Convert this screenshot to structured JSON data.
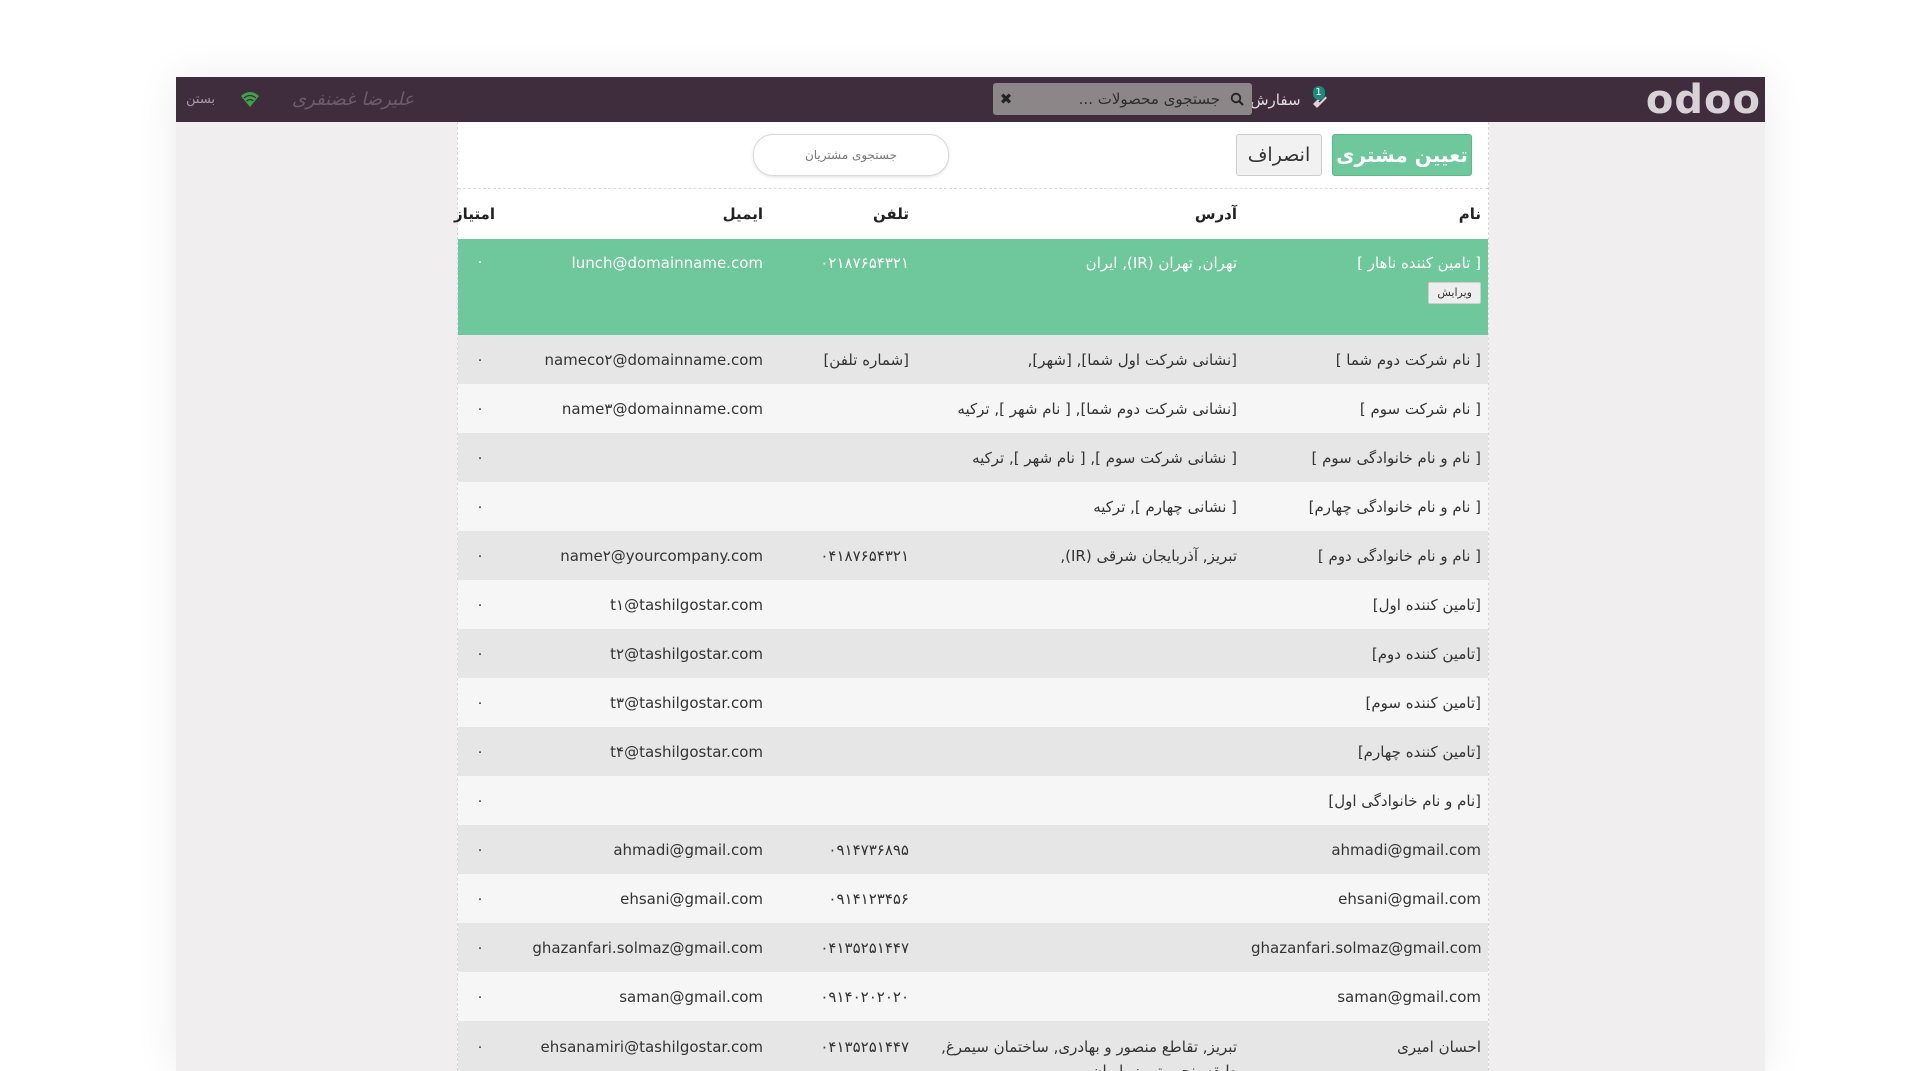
{
  "app": {
    "logo": "odoo"
  },
  "header": {
    "orders_label": "سفارش ها",
    "orders_badge": "1",
    "product_search_placeholder": "جستجوی محصولات ...",
    "user_name": "علیرضا غضنفری",
    "close_label": "بستن"
  },
  "actions": {
    "assign_label": "تعیین مشتری",
    "cancel_label": "انصراف",
    "customer_search_placeholder": "جستجوی مشتریان"
  },
  "table": {
    "headers": {
      "name": "نام",
      "address": "آدرس",
      "phone": "تلفن",
      "email": "ایمیل",
      "points": "امتیاز"
    },
    "edit_label": "ویرایش",
    "rows": [
      {
        "name": "[ تامین کننده ناهار ]",
        "address": "تهران, تهران (IR), ایران",
        "phone": "۰۲۱۸۷۶۵۴۳۲۱",
        "email": "lunch@domainname.com",
        "points": "۰"
      },
      {
        "name": "[ نام شرکت دوم شما ]",
        "address": "[نشانی شرکت اول شما], [شهر],",
        "phone": "[شماره تلفن]",
        "email": "nameco۲@domainname.com",
        "points": "۰"
      },
      {
        "name": "[ نام شرکت سوم ]",
        "address": "[نشانی شرکت دوم شما], [ نام شهر ], ترکیه",
        "phone": "",
        "email": "name۳@domainname.com",
        "points": "۰"
      },
      {
        "name": "[ نام و نام خانوادگی سوم ]",
        "address": "[ نشانی شرکت سوم ], [ نام شهر ], ترکیه",
        "phone": "",
        "email": "",
        "points": "۰"
      },
      {
        "name": "[ نام و نام خانوادگی چهارم]",
        "address": "[ نشانی چهارم ], ترکیه",
        "phone": "",
        "email": "",
        "points": "۰"
      },
      {
        "name": "[ نام و نام خانوادگی دوم ]",
        "address": "تبریز, آذربایجان شرقی (IR),",
        "phone": "۰۴۱۸۷۶۵۴۳۲۱",
        "email": "name۲@yourcompany.com",
        "points": "۰"
      },
      {
        "name": "[تامین کننده اول]",
        "address": "",
        "phone": "",
        "email": "t۱@tashilgostar.com",
        "points": "۰"
      },
      {
        "name": "[تامین کننده دوم]",
        "address": "",
        "phone": "",
        "email": "t۲@tashilgostar.com",
        "points": "۰"
      },
      {
        "name": "[تامین کننده سوم]",
        "address": "",
        "phone": "",
        "email": "t۳@tashilgostar.com",
        "points": "۰"
      },
      {
        "name": "[تامین کننده چهارم]",
        "address": "",
        "phone": "",
        "email": "t۴@tashilgostar.com",
        "points": "۰"
      },
      {
        "name": "[نام و نام خانوادگی اول]",
        "address": "",
        "phone": "",
        "email": "",
        "points": "۰"
      },
      {
        "name": "ahmadi@gmail.com",
        "address": "",
        "phone": "۰۹۱۴۷۳۶۸۹۵",
        "email": "ahmadi@gmail.com",
        "points": "۰"
      },
      {
        "name": "ehsani@gmail.com",
        "address": "",
        "phone": "۰۹۱۴۱۲۳۴۵۶",
        "email": "ehsani@gmail.com",
        "points": "۰"
      },
      {
        "name": "ghazanfari.solmaz@gmail.com",
        "address": "",
        "phone": "۰۴۱۳۵۲۵۱۴۴۷",
        "email": "ghazanfari.solmaz@gmail.com",
        "points": "۰"
      },
      {
        "name": "saman@gmail.com",
        "address": "",
        "phone": "۰۹۱۴۰۲۰۲۰۲۰",
        "email": "saman@gmail.com",
        "points": "۰"
      },
      {
        "name": "احسان امیری",
        "address": "تبریز, تقاطع منصور و بهادری, ساختمان سیمرغ, طبقه پنجم, تبریز, ایران",
        "phone": "۰۴۱۳۵۲۵۱۴۴۷",
        "email": "ehsanamiri@tashilgostar.com",
        "points": "۰"
      }
    ]
  }
}
